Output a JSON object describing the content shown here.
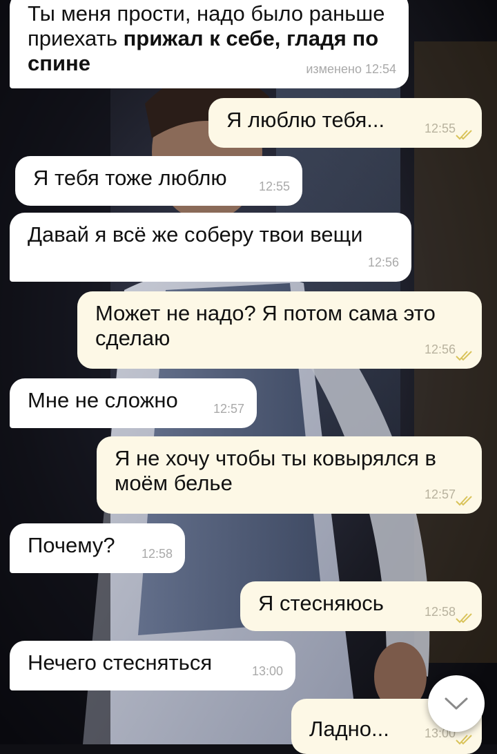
{
  "theme": {
    "incoming_bubble": "#ffffff",
    "outgoing_bubble": "#fdf8e6",
    "ticks_color": "#d9c35a",
    "time_color": "#a9a9a9"
  },
  "messages": [
    {
      "direction": "in",
      "text_plain": "Ты меня прости, надо было раньше приехать ",
      "text_bold": "прижал к себе, гладя по спине",
      "time": "изменено 12:54"
    },
    {
      "direction": "out",
      "text": "Я люблю тебя...",
      "time": "12:55",
      "status_icon": "double-check-icon"
    },
    {
      "direction": "in",
      "text": "Я тебя тоже люблю",
      "time": "12:55"
    },
    {
      "direction": "in",
      "text": "Давай я всё же соберу твои вещи",
      "time": "12:56"
    },
    {
      "direction": "out",
      "text": "Может не надо? Я потом сама это сделаю",
      "time": "12:56",
      "status_icon": "double-check-icon"
    },
    {
      "direction": "in",
      "text": "Мне не сложно",
      "time": "12:57"
    },
    {
      "direction": "out",
      "text": "Я не хочу чтобы ты ковырялся в моём белье",
      "time": "12:57",
      "status_icon": "double-check-icon"
    },
    {
      "direction": "in",
      "text": "Почему?",
      "time": "12:58"
    },
    {
      "direction": "out",
      "text": "Я стесняюсь",
      "time": "12:58",
      "status_icon": "double-check-icon"
    },
    {
      "direction": "in",
      "text": "Нечего стесняться",
      "time": "13:00"
    },
    {
      "direction": "out",
      "text": "Ладно...",
      "time": "13:00",
      "status_icon": "double-check-icon"
    }
  ],
  "scroll_button": {
    "icon": "chevron-down-icon"
  }
}
